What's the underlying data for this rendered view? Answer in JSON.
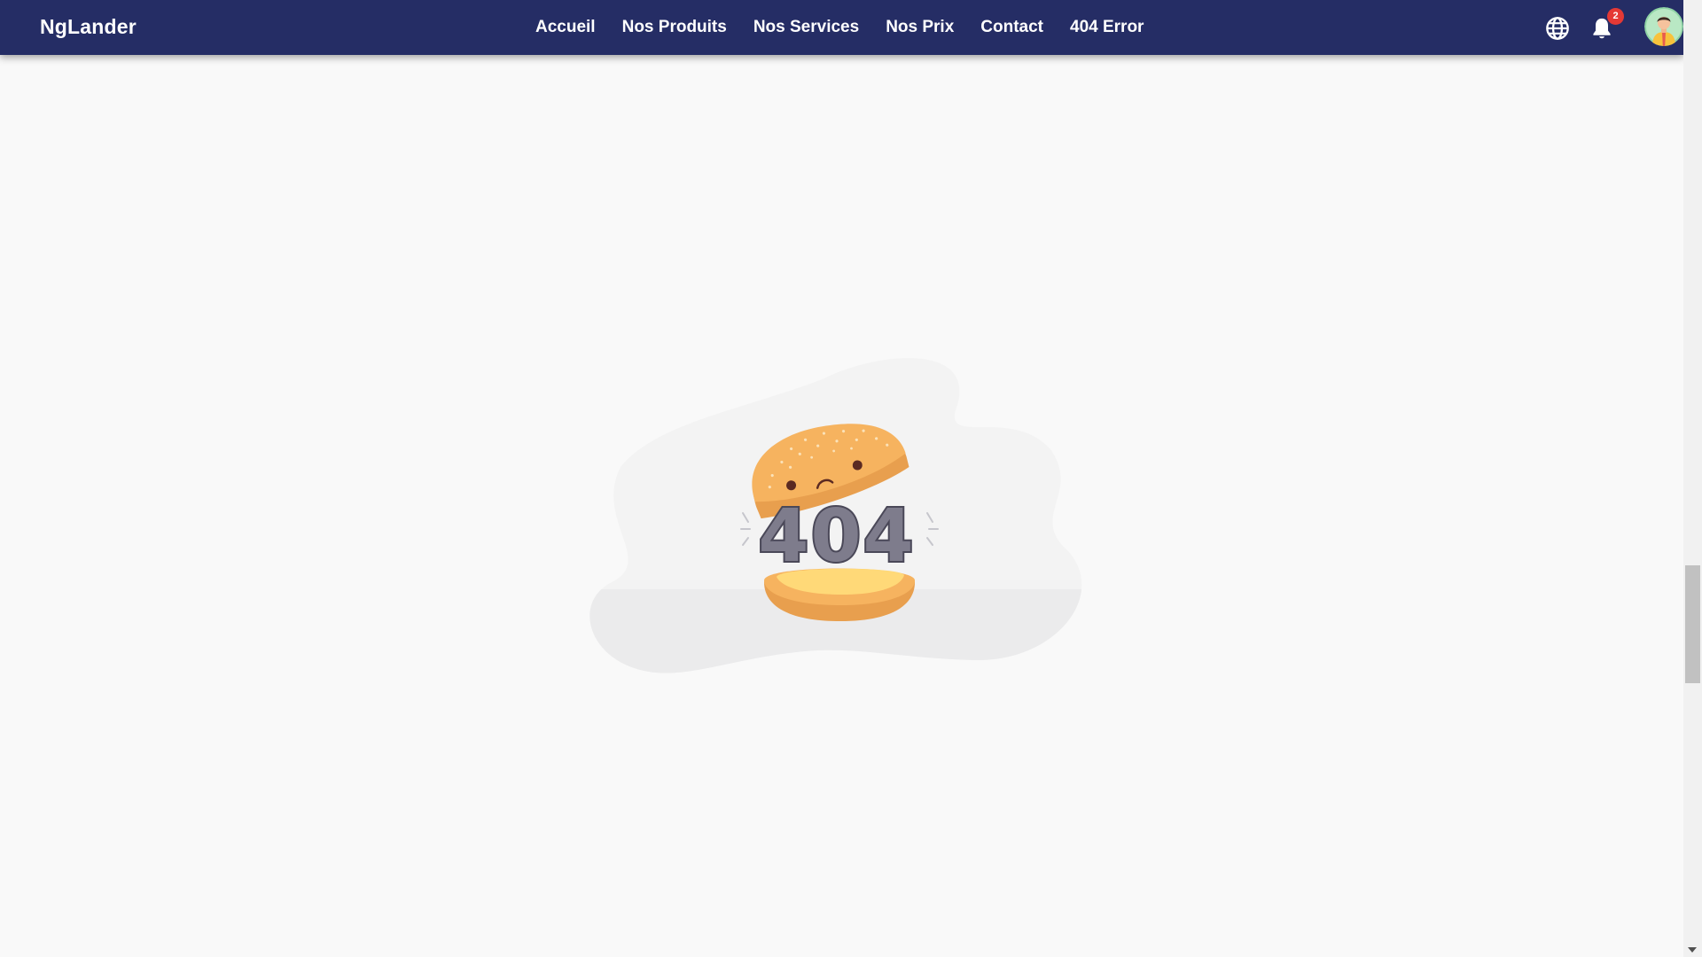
{
  "navbar": {
    "brand": "NgLander",
    "links": [
      {
        "label": "Accueil"
      },
      {
        "label": "Nos Produits"
      },
      {
        "label": "Nos Services"
      },
      {
        "label": "Nos Prix"
      },
      {
        "label": "Contact"
      },
      {
        "label": "404 Error"
      }
    ],
    "notification_count": "2",
    "icons": {
      "language": "globe-icon",
      "notifications": "bell-icon",
      "profile": "avatar"
    }
  },
  "error": {
    "code_text": "404"
  },
  "colors": {
    "navbar_bg": "#252d65",
    "page_bg": "#f9f9f9",
    "badge": "#e53935",
    "bun": "#f6b35f",
    "cheese": "#ffd978",
    "digits": "#7e7c8c"
  }
}
